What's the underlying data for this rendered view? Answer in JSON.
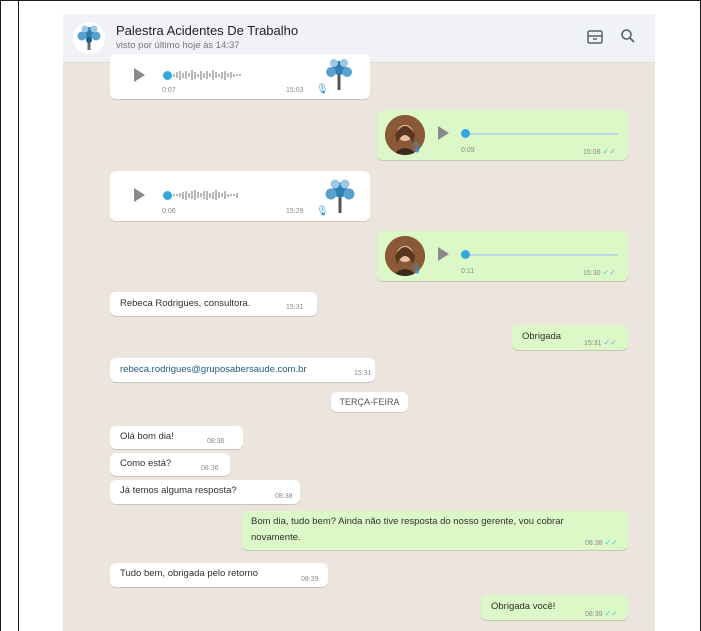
{
  "header": {
    "contact_name": "Palestra Acidentes De Trabalho",
    "status": "visto por último hoje às 14:37",
    "icons": [
      "group-avatar-icon",
      "store-icon",
      "search-icon"
    ]
  },
  "messages": {
    "voice1": {
      "duration": "0:07",
      "time": "15:03"
    },
    "voice2": {
      "duration": "0:09",
      "time": "15:08",
      "status": "read"
    },
    "voice3": {
      "duration": "0:06",
      "time": "15:29"
    },
    "voice4": {
      "duration": "0:11",
      "time": "15:30",
      "status": "read"
    },
    "text1": {
      "text": "Rebeca Rodrigues, consultora.",
      "time": "15:31"
    },
    "text2": {
      "text": "Obrigada",
      "time": "15:31",
      "status": "read"
    },
    "text3": {
      "text": "rebeca.rodrigues@gruposabersaude.com.br",
      "time": "15:31"
    },
    "day_divider": "TERÇA-FEIRA",
    "text4": {
      "text": "Olá bom dia!",
      "time": "08:36"
    },
    "text5": {
      "text": "Como está?",
      "time": "08:36"
    },
    "text6": {
      "text": "Já temos alguma resposta?",
      "time": "08:38"
    },
    "text7": {
      "line1": "Bom dia, tudo bem? Ainda não tive resposta do nosso gerente, vou cobrar",
      "line2": "novamente.",
      "time": "08:38",
      "status": "read"
    },
    "text8": {
      "text": "Tudo bem, obrigada pelo retorno",
      "time": "08:39"
    },
    "text9": {
      "text": "Obrigada você!",
      "time": "08:39",
      "status": "read"
    }
  },
  "colors": {
    "incoming_bubble": "#ffffff",
    "outgoing_bubble": "#dcf8c6",
    "chat_background": "#ece5dd",
    "read_tick": "#53bdeb",
    "voice_dot": "#34a7e0"
  }
}
